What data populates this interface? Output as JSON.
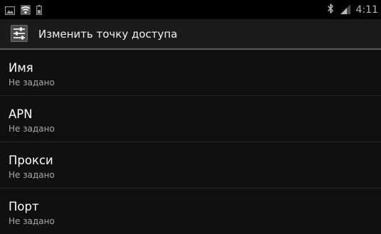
{
  "status_bar": {
    "time": "4:11",
    "icons": [
      "picture-icon",
      "wifi-icon",
      "battery-icon",
      "bluetooth-icon",
      "signal-icon"
    ]
  },
  "action_bar": {
    "icon": "settings-sliders-icon",
    "title": "Изменить точку доступа"
  },
  "preferences": [
    {
      "label": "Имя",
      "summary": "Не задано"
    },
    {
      "label": "APN",
      "summary": "Не задано"
    },
    {
      "label": "Прокси",
      "summary": "Не задано"
    },
    {
      "label": "Порт",
      "summary": "Не задано"
    }
  ],
  "colors": {
    "status_bar": "#000000",
    "action_bar": "#1b1b1b",
    "background": "#101010",
    "divider": "#5a5a5a",
    "summary_text": "#a8a8a8"
  }
}
